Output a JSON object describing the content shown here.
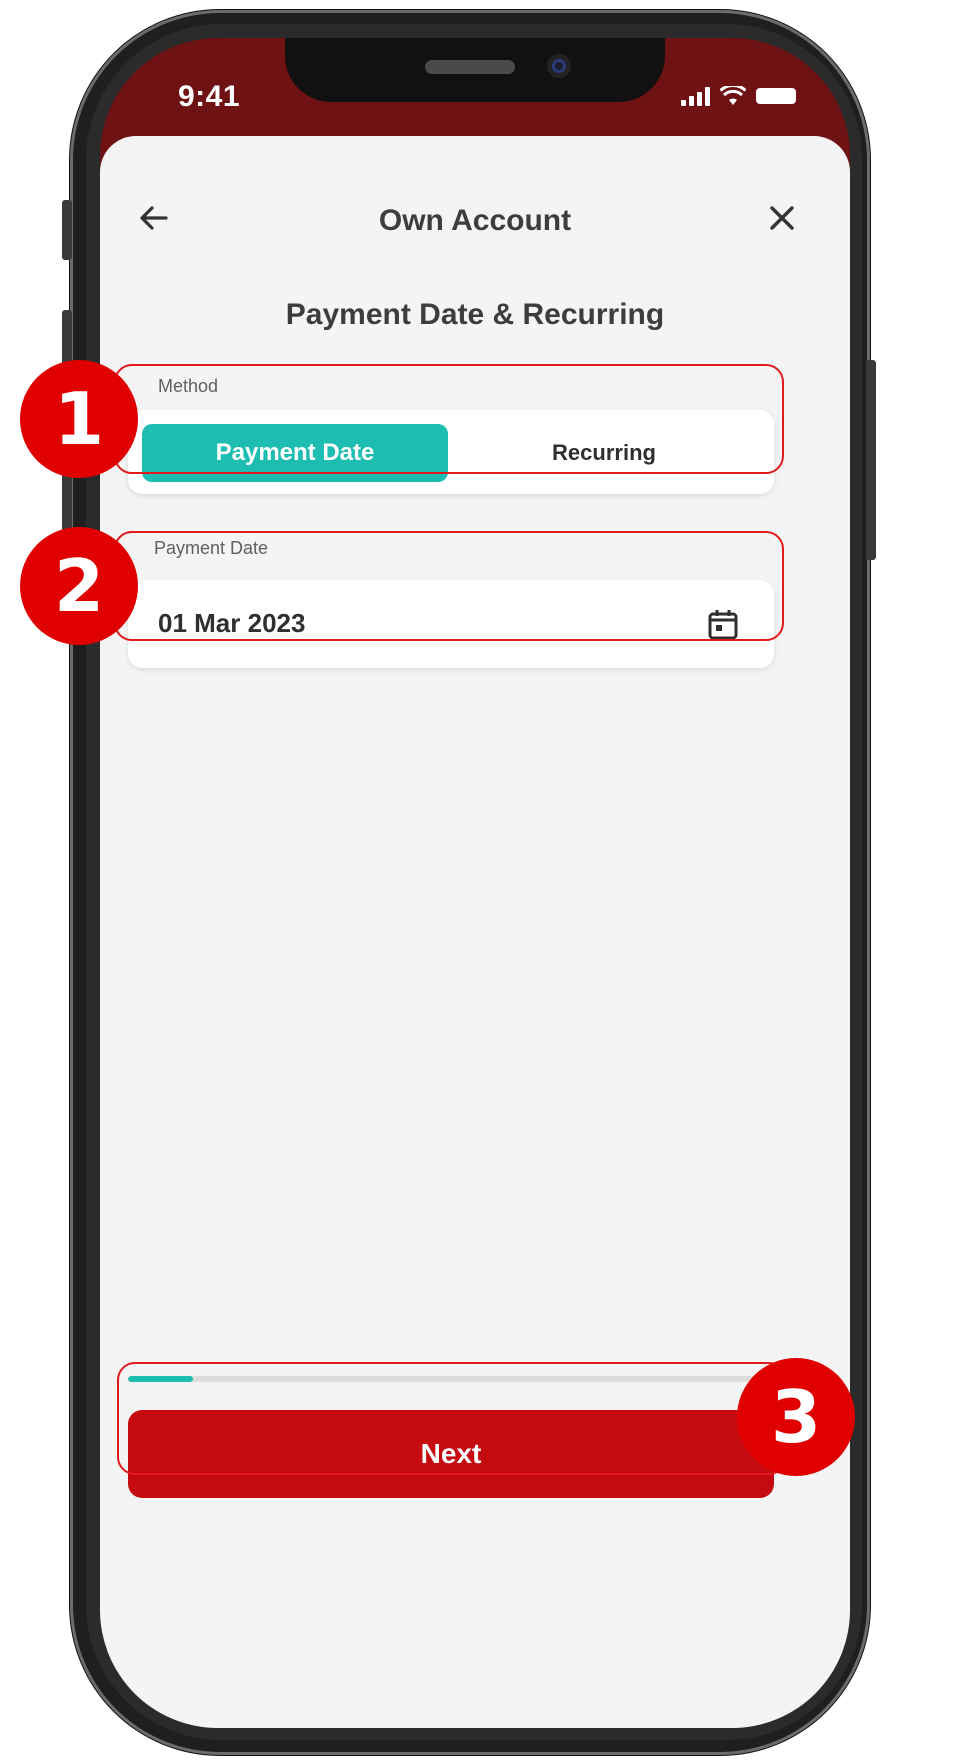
{
  "status_bar": {
    "time": "9:41"
  },
  "header": {
    "title": "Own Account",
    "back_icon": "arrow-left-icon",
    "close_icon": "close-icon"
  },
  "page_title": "Payment Date & Recurring",
  "method": {
    "label": "Method",
    "options": [
      "Payment Date",
      "Recurring"
    ],
    "selected": "Payment Date"
  },
  "payment_date": {
    "label": "Payment Date",
    "value": "01 Mar 2023",
    "icon": "calendar-icon"
  },
  "progress": {
    "fraction": 0.1
  },
  "next_button": {
    "label": "Next"
  },
  "annotations": {
    "badge1": "1",
    "badge2": "2",
    "badge3": "3"
  },
  "colors": {
    "accent_teal": "#1ebdb2",
    "primary_red": "#c50b10",
    "status_bar_maroon": "#6e1214",
    "annotation_red": "#e10000"
  }
}
